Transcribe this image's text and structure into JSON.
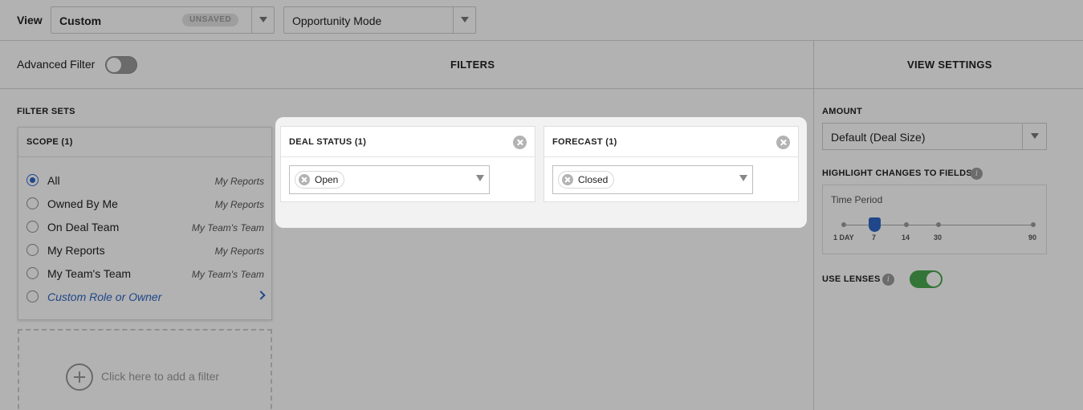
{
  "topbar": {
    "view_label": "View",
    "view_select_value": "Custom",
    "unsaved_badge": "UNSAVED",
    "mode_select_value": "Opportunity Mode"
  },
  "header": {
    "advanced_filter_label": "Advanced Filter",
    "advanced_filter_on": false,
    "filters_title": "FILTERS",
    "view_settings_title": "VIEW SETTINGS"
  },
  "filter_sets": {
    "label": "FILTER SETS",
    "scope": {
      "title": "SCOPE (1)",
      "items": [
        {
          "label": "All",
          "tag": "My Reports",
          "checked": true
        },
        {
          "label": "Owned By Me",
          "tag": "My Reports",
          "checked": false
        },
        {
          "label": "On Deal Team",
          "tag": "My Team's Team",
          "checked": false
        },
        {
          "label": "My Reports",
          "tag": "My Reports",
          "checked": false
        },
        {
          "label": "My Team's Team",
          "tag": "My Team's Team",
          "checked": false
        },
        {
          "label": "Custom Role or Owner",
          "tag": "",
          "checked": false
        }
      ]
    },
    "add_filter_text": "Click here to add a filter"
  },
  "highlighted_filters": [
    {
      "title": "DEAL STATUS (1)",
      "chip": "Open"
    },
    {
      "title": "FORECAST (1)",
      "chip": "Closed"
    }
  ],
  "view_settings": {
    "amount_label": "AMOUNT",
    "amount_value": "Default (Deal Size)",
    "highlight_label": "HIGHLIGHT CHANGES TO FIELDS",
    "time_period_label": "Time Period",
    "time_ticks": [
      "1 DAY",
      "7",
      "14",
      "30",
      "90"
    ],
    "time_selected": "7",
    "use_lenses_label": "USE LENSES",
    "use_lenses_on": true
  },
  "colors": {
    "accent_blue": "#2f66c6",
    "toggle_green": "#4aa84e"
  }
}
